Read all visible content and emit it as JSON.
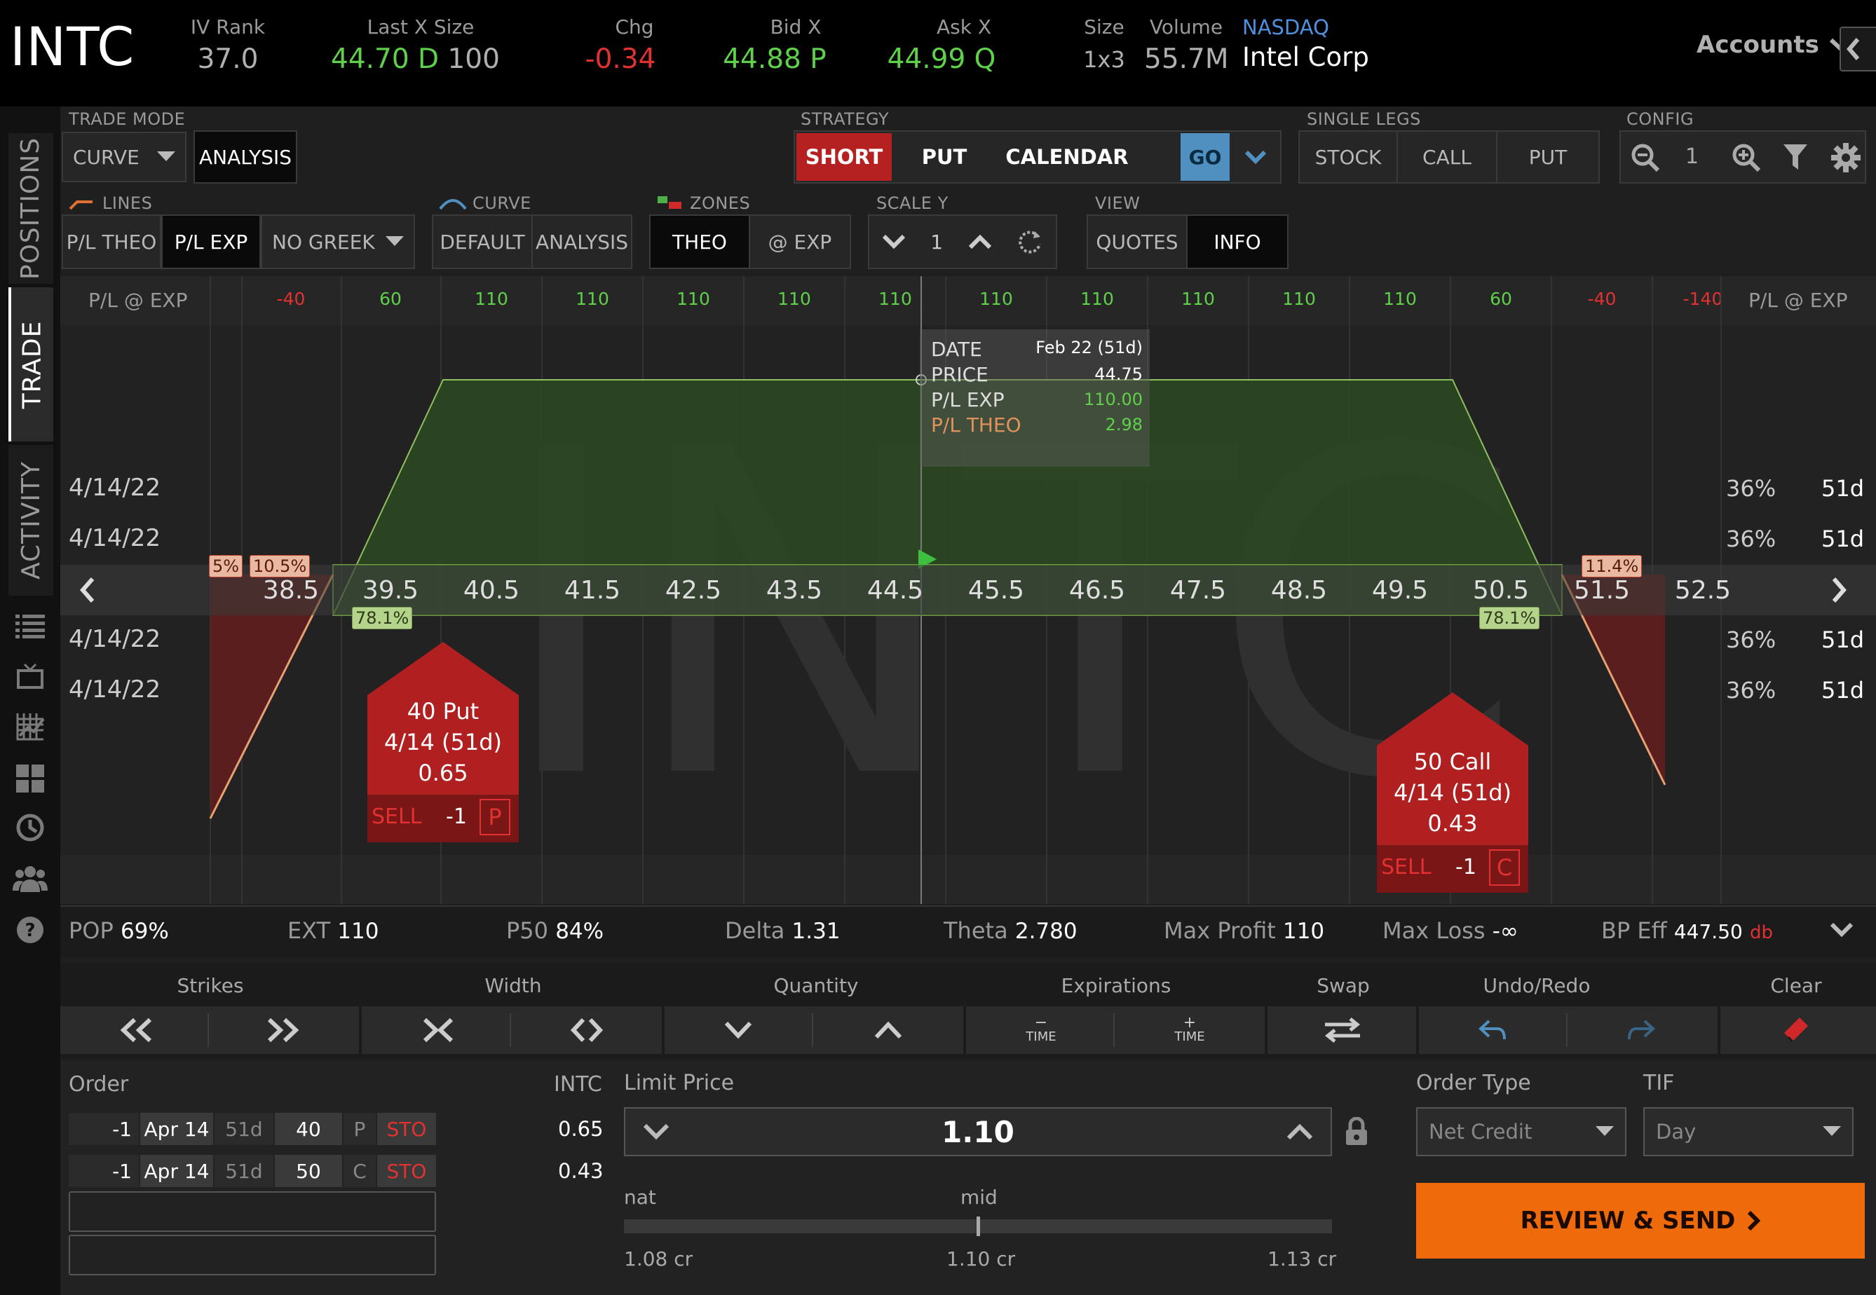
{
  "header": {
    "symbol": "INTC",
    "iv_rank_label": "IV Rank",
    "iv_rank": "37.0",
    "last_label": "Last X Size",
    "last_price": "44.70 D",
    "last_size": "100",
    "chg_label": "Chg",
    "chg": "-0.34",
    "bid_label": "Bid X",
    "bid": "44.88 P",
    "ask_label": "Ask X",
    "ask": "44.99 Q",
    "size_label": "Size",
    "size": "1x3",
    "volume_label": "Volume",
    "volume": "55.7M",
    "exchange": "NASDAQ",
    "company": "Intel Corp",
    "accounts": "Accounts"
  },
  "sidebar": {
    "positions": "POSITIONS",
    "trade": "TRADE",
    "activity": "ACTIVITY",
    "icons": [
      "list-icon",
      "tv-icon",
      "chart-icon",
      "grid-icon",
      "clock-icon",
      "community-icon",
      "help-icon"
    ]
  },
  "toolbar": {
    "trade_mode_label": "TRADE MODE",
    "trade_mode": "CURVE",
    "analysis": "ANALYSIS",
    "strategy_label": "STRATEGY",
    "short": "SHORT",
    "put": "PUT",
    "calendar": "CALENDAR",
    "go": "GO",
    "single_legs_label": "SINGLE LEGS",
    "stock": "STOCK",
    "call": "CALL",
    "put2": "PUT",
    "config_label": "CONFIG",
    "config_value": "1",
    "lines_label": "LINES",
    "pl_theo": "P/L THEO",
    "pl_exp": "P/L EXP",
    "no_greek": "NO GREEK",
    "curve_label": "CURVE",
    "default": "DEFAULT",
    "curve_analysis": "ANALYSIS",
    "zones_label": "ZONES",
    "theo": "THEO",
    "at_exp": "@ EXP",
    "scale_label": "SCALE Y",
    "scale_value": "1",
    "view_label": "VIEW",
    "quotes": "QUOTES",
    "info": "INFO"
  },
  "pl_row": {
    "label": "P/L @ EXP",
    "values": [
      "-40",
      "60",
      "110",
      "110",
      "110",
      "110",
      "110",
      "110",
      "110",
      "110",
      "110",
      "110",
      "60",
      "-40",
      "-140"
    ]
  },
  "strikes": [
    "38.5",
    "39.5",
    "40.5",
    "41.5",
    "42.5",
    "43.5",
    "44.5",
    "45.5",
    "46.5",
    "47.5",
    "48.5",
    "49.5",
    "50.5",
    "51.5",
    "52.5"
  ],
  "expiry_rows": [
    {
      "date": "4/14/22",
      "iv": "36%",
      "dte": "51d"
    },
    {
      "date": "4/14/22",
      "iv": "36%",
      "dte": "51d"
    },
    {
      "date": "4/14/22",
      "iv": "36%",
      "dte": "51d"
    },
    {
      "date": "4/14/22",
      "iv": "36%",
      "dte": "51d"
    }
  ],
  "tooltip": {
    "date_key": "DATE",
    "date_val": "Feb 22 (51d)",
    "price_key": "PRICE",
    "price_val": "44.75",
    "plexp_key": "P/L EXP",
    "plexp_val": "110.00",
    "pltheo_key": "P/L THEO",
    "pltheo_val": "2.98"
  },
  "chart_flags": {
    "left_a": "5%",
    "left_b": "10.5%",
    "left_prob": "78.1%",
    "right_a": "11.4%",
    "right_prob": "78.1%"
  },
  "legs": [
    {
      "line1": "40 Put",
      "line2": "4/14 (51d)",
      "line3": "0.65",
      "side": "SELL",
      "qty": "-1",
      "type": "P"
    },
    {
      "line1": "50 Call",
      "line2": "4/14 (51d)",
      "line3": "0.43",
      "side": "SELL",
      "qty": "-1",
      "type": "C"
    }
  ],
  "stats": {
    "pop_k": "POP",
    "pop": "69%",
    "ext_k": "EXT",
    "ext": "110",
    "p50_k": "P50",
    "p50": "84%",
    "delta_k": "Delta",
    "delta": "1.31",
    "theta_k": "Theta",
    "theta": "2.780",
    "maxp_k": "Max Profit",
    "maxp": "110",
    "maxl_k": "Max Loss",
    "maxl": "-∞",
    "bp_k": "BP Eff",
    "bp": "447.50",
    "bp_unit": "db"
  },
  "tools": {
    "strikes": "Strikes",
    "width": "Width",
    "quantity": "Quantity",
    "expirations": "Expirations",
    "swap": "Swap",
    "undo": "Undo/Redo",
    "clear": "Clear",
    "time": "TIME"
  },
  "order": {
    "label": "Order",
    "symbol": "INTC",
    "rows": [
      {
        "qty": "-1",
        "exp": "Apr 14",
        "dte": "51d",
        "strike": "40",
        "type": "P",
        "action": "STO",
        "price": "0.65"
      },
      {
        "qty": "-1",
        "exp": "Apr 14",
        "dte": "51d",
        "strike": "50",
        "type": "C",
        "action": "STO",
        "price": "0.43"
      }
    ],
    "limit_label": "Limit Price",
    "limit": "1.10",
    "nat_label": "nat",
    "mid_label": "mid",
    "nat": "1.08 cr",
    "mid": "1.10 cr",
    "far": "1.13 cr",
    "order_type_label": "Order Type",
    "order_type": "Net Credit",
    "tif_label": "TIF",
    "tif": "Day",
    "review": "REVIEW & SEND"
  },
  "colors": {
    "green": "#5fd04a",
    "red": "#e23131",
    "orange": "#ef6a0a",
    "sell_red": "#b02020",
    "blue": "#4f90c0"
  }
}
